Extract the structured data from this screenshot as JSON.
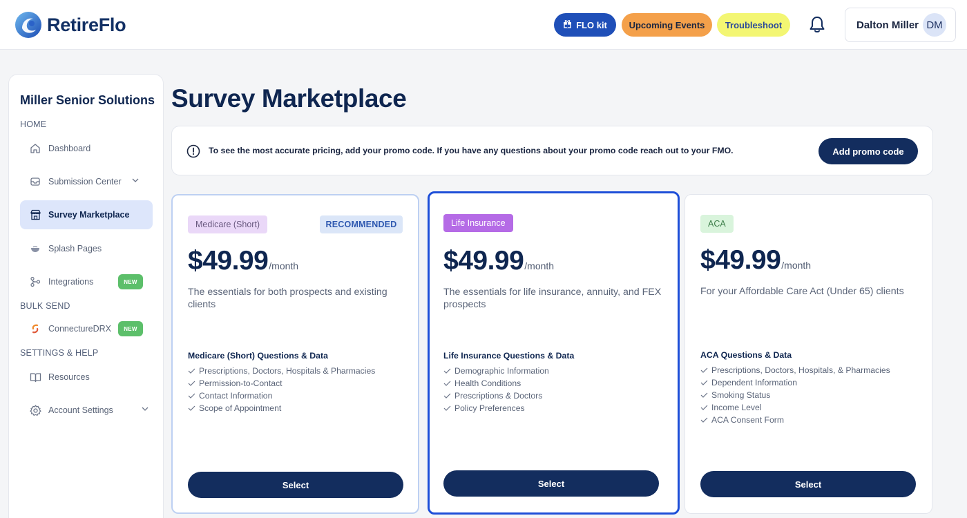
{
  "app": {
    "name": "RetireFlo"
  },
  "header": {
    "flo_kit": "FLO kit",
    "upcoming_events": "Upcoming Events",
    "troubleshoot": "Troubleshoot",
    "user_name": "Dalton Miller",
    "user_initials": "DM"
  },
  "sidebar": {
    "org_name": "Miller Senior Solutions",
    "sections": {
      "home": "HOME",
      "bulk_send": "BULK SEND",
      "settings_help": "SETTINGS & HELP"
    },
    "items": [
      {
        "label": "Dashboard",
        "icon": "home-icon"
      },
      {
        "label": "Submission Center",
        "icon": "inbox-icon",
        "expandable": true
      },
      {
        "label": "Survey Marketplace",
        "icon": "storefront-icon",
        "active": true
      },
      {
        "label": "Splash Pages",
        "icon": "bowl-icon"
      },
      {
        "label": "Integrations",
        "icon": "integrations-icon",
        "badge": "NEW"
      },
      {
        "label": "ConnectureDRX",
        "icon": "connecture-icon",
        "badge": "NEW"
      },
      {
        "label": "Resources",
        "icon": "book-icon"
      },
      {
        "label": "Account Settings",
        "icon": "gear-icon",
        "expandable": true
      }
    ]
  },
  "main": {
    "title": "Survey Marketplace",
    "promo": {
      "text": "To see the most accurate pricing, add your promo code. If you have any questions about your promo code reach out to your FMO.",
      "button": "Add promo code"
    },
    "cards": [
      {
        "tag": "Medicare (Short)",
        "badge": "RECOMMENDED",
        "price": "$49.99",
        "period": "/month",
        "description": "The essentials for both prospects and existing clients",
        "features_title": "Medicare (Short) Questions & Data",
        "features": [
          "Prescriptions, Doctors, Hospitals & Pharmacies",
          "Permission-to-Contact",
          "Contact Information",
          "Scope of Appointment"
        ],
        "button": "Select"
      },
      {
        "tag": "Life Insurance",
        "price": "$49.99",
        "period": "/month",
        "description": "The essentials for life insurance, annuity, and FEX prospects",
        "features_title": "Life Insurance Questions & Data",
        "features": [
          "Demographic Information",
          "Health Conditions",
          "Prescriptions & Doctors",
          "Policy Preferences"
        ],
        "button": "Select"
      },
      {
        "tag": "ACA",
        "price": "$49.99",
        "period": "/month",
        "description": "For your Affordable Care Act (Under 65) clients",
        "features_title": "ACA Questions & Data",
        "features": [
          "Prescriptions, Doctors, Hospitals, & Pharmacies",
          "Dependent Information",
          "Smoking Status",
          "Income Level",
          "ACA Consent Form"
        ],
        "button": "Select"
      }
    ]
  },
  "colors": {
    "navy": "#132d5e",
    "brand_blue": "#1f4fb8",
    "events_orange": "#f4a04a",
    "troubleshoot_yellow": "#f3f673",
    "selected_border": "#1d4ed8",
    "new_badge_green": "#5cbf6a"
  }
}
